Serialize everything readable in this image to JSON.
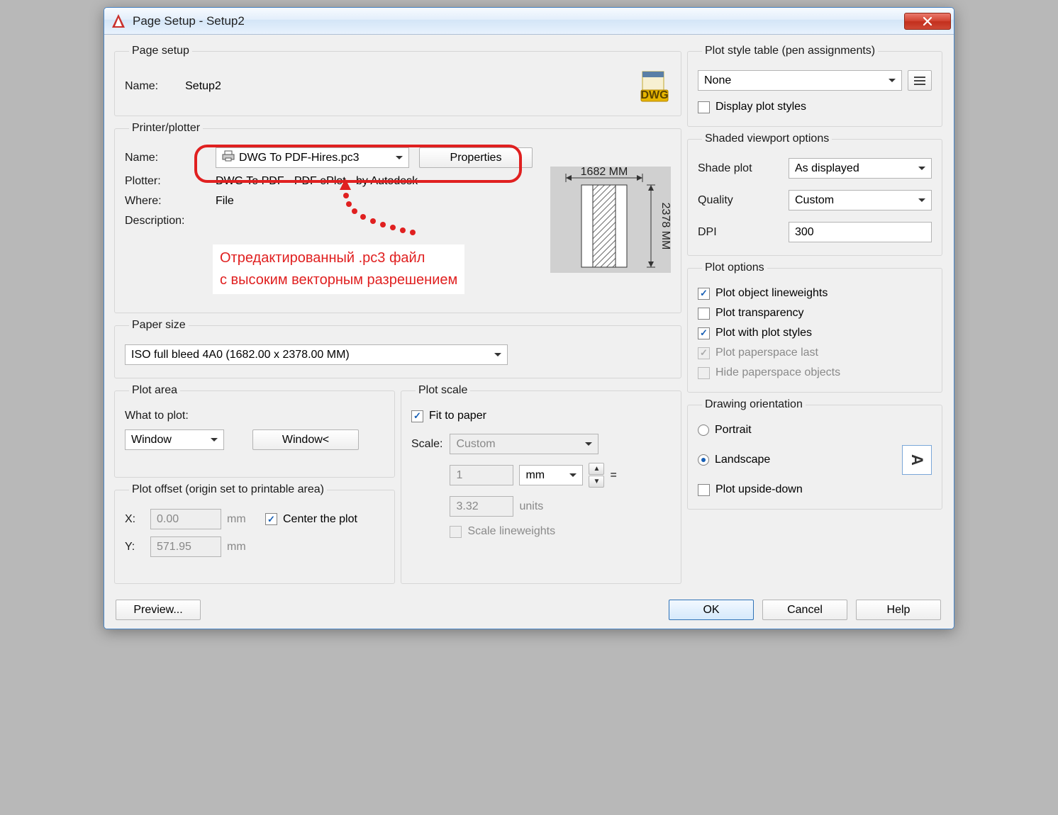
{
  "window": {
    "title": "Page Setup - Setup2"
  },
  "pagesetup": {
    "legend": "Page setup",
    "name_label": "Name:",
    "name_value": "Setup2"
  },
  "printer": {
    "legend": "Printer/plotter",
    "name_label": "Name:",
    "name_value": "DWG To PDF-Hires.pc3",
    "properties_btn": "Properties",
    "plotter_label": "Plotter:",
    "plotter_value": "DWG To PDF - PDF ePlot - by Autodesk",
    "where_label": "Where:",
    "where_value": "File",
    "desc_label": "Description:",
    "desc_value": "",
    "preview_width": "1682 MM",
    "preview_height": "2378 MM"
  },
  "annotation": {
    "line1": "Отредактированный .pc3 файл",
    "line2": "с высоким векторным разрешением"
  },
  "papersize": {
    "legend": "Paper size",
    "value": "ISO full bleed 4A0 (1682.00 x 2378.00 MM)"
  },
  "plotarea": {
    "legend": "Plot area",
    "what_label": "What to plot:",
    "what_value": "Window",
    "window_btn": "Window<"
  },
  "plotoffset": {
    "legend": "Plot offset (origin set to printable area)",
    "x_label": "X:",
    "x_value": "0.00",
    "x_unit": "mm",
    "y_label": "Y:",
    "y_value": "571.95",
    "y_unit": "mm",
    "center_label": "Center the plot"
  },
  "plotscale": {
    "legend": "Plot scale",
    "fit_label": "Fit to paper",
    "scale_label": "Scale:",
    "scale_value": "Custom",
    "num_value": "1",
    "num_unit": "mm",
    "equals": "=",
    "den_value": "3.32",
    "den_unit": "units",
    "scale_lw_label": "Scale lineweights"
  },
  "plotstyle": {
    "legend": "Plot style table (pen assignments)",
    "value": "None",
    "display_styles_label": "Display plot styles"
  },
  "shaded": {
    "legend": "Shaded viewport options",
    "shade_label": "Shade plot",
    "shade_value": "As displayed",
    "quality_label": "Quality",
    "quality_value": "Custom",
    "dpi_label": "DPI",
    "dpi_value": "300"
  },
  "plotoptions": {
    "legend": "Plot options",
    "lineweights": "Plot object lineweights",
    "transparency": "Plot transparency",
    "withstyles": "Plot with plot styles",
    "paperspace_last": "Plot paperspace last",
    "hide_paperspace": "Hide paperspace objects"
  },
  "orientation": {
    "legend": "Drawing orientation",
    "portrait": "Portrait",
    "landscape": "Landscape",
    "upside_down": "Plot upside-down"
  },
  "footer": {
    "preview": "Preview...",
    "ok": "OK",
    "cancel": "Cancel",
    "help": "Help"
  }
}
